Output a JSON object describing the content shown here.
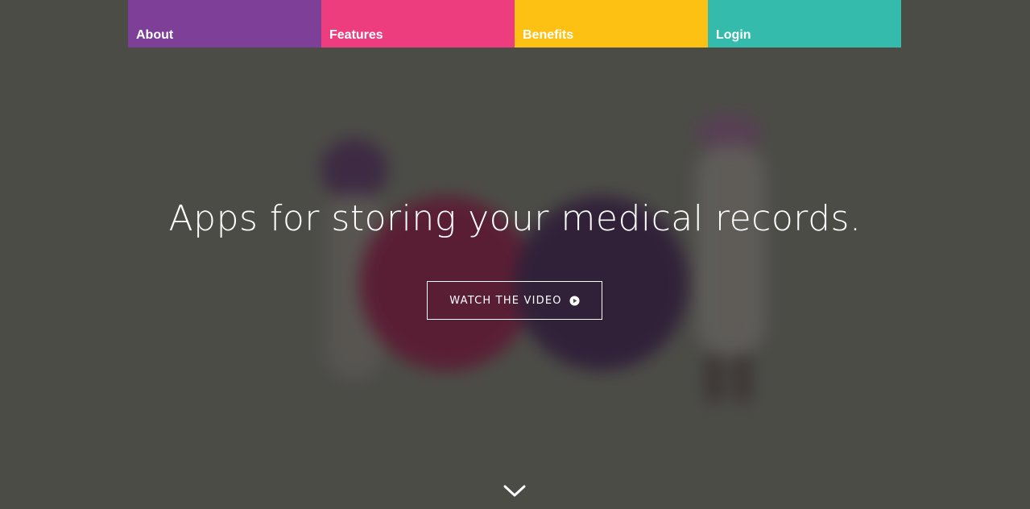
{
  "nav": {
    "items": [
      {
        "label": "About",
        "color": "#7d3f98"
      },
      {
        "label": "Features",
        "color": "#ee3d7e"
      },
      {
        "label": "Benefits",
        "color": "#fdc114"
      },
      {
        "label": "Login",
        "color": "#34bbab"
      }
    ]
  },
  "hero": {
    "headline": "Apps for storing your medical records.",
    "video_button_label": "WATCH THE VIDEO",
    "video_button_icon": "play-circle-icon",
    "scroll_icon": "chevron-down-icon",
    "background_color": "#4c4c47"
  }
}
